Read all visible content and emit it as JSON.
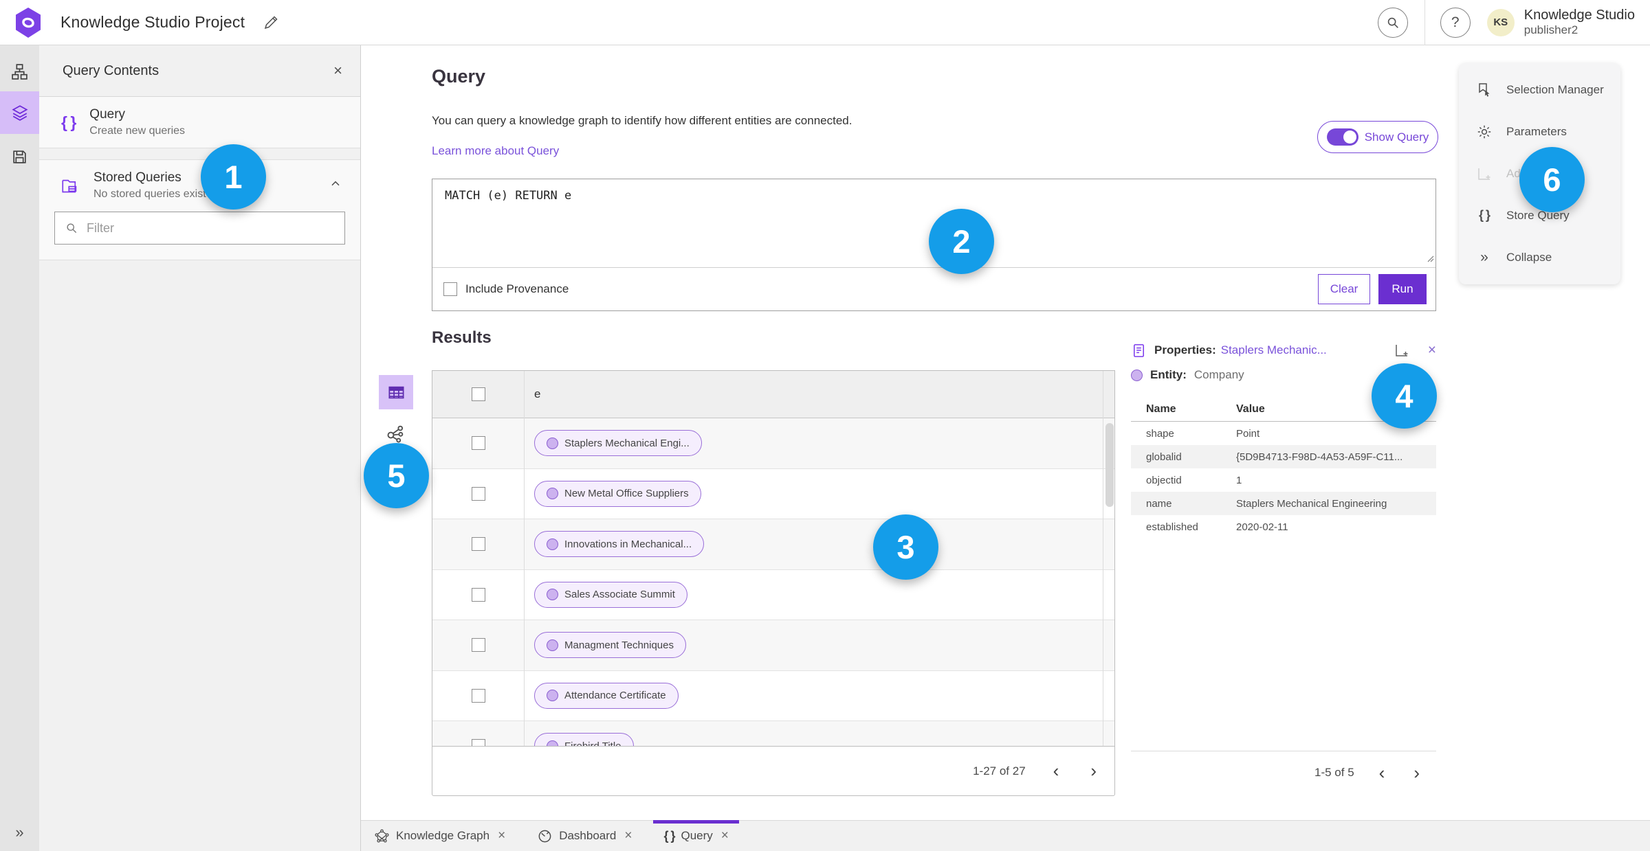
{
  "header": {
    "app_title": "Knowledge Studio Project",
    "user_name": "Knowledge Studio",
    "user_role": "publisher2",
    "avatar_initials": "KS"
  },
  "icons": {
    "braces": "{ }",
    "help": "?",
    "close": "×",
    "chevron_left": "‹",
    "chevron_right": "›",
    "collapse": "»",
    "expand": "»"
  },
  "left_panel": {
    "title": "Query Contents",
    "query_item": {
      "title": "Query",
      "subtitle": "Create new queries"
    },
    "stored_queries": {
      "title": "Stored Queries",
      "subtitle": "No stored queries exist"
    },
    "filter_placeholder": "Filter"
  },
  "query_section": {
    "title": "Query",
    "description": "You can query a knowledge graph to identify how different entities are connected.",
    "learn_more": "Learn more about Query",
    "show_query_label": "Show Query",
    "query_text": "MATCH (e) RETURN e",
    "include_provenance_label": "Include Provenance",
    "clear_label": "Clear",
    "run_label": "Run"
  },
  "results": {
    "title": "Results",
    "column_header": "e",
    "rows": [
      {
        "label": "Staplers Mechanical Engi..."
      },
      {
        "label": "New Metal Office Suppliers"
      },
      {
        "label": "Innovations in Mechanical..."
      },
      {
        "label": "Sales Associate Summit"
      },
      {
        "label": "Managment Techniques"
      },
      {
        "label": "Attendance Certificate"
      },
      {
        "label": "Firebird Title"
      }
    ],
    "pagination": "1-27 of 27"
  },
  "properties": {
    "title_label": "Properties:",
    "title_link": "Staplers Mechanic...",
    "entity_label": "Entity:",
    "entity_value": "Company",
    "columns": {
      "name": "Name",
      "value": "Value"
    },
    "rows": [
      {
        "name": "shape",
        "value": "Point"
      },
      {
        "name": "globalid",
        "value": "{5D9B4713-F98D-4A53-A59F-C11..."
      },
      {
        "name": "objectid",
        "value": "1"
      },
      {
        "name": "name",
        "value": "Staplers Mechanical Engineering"
      },
      {
        "name": "established",
        "value": "2020-02-11"
      }
    ],
    "pagination": "1-5 of 5"
  },
  "right_menu": {
    "items": [
      {
        "label": "Selection Manager"
      },
      {
        "label": "Parameters"
      },
      {
        "label": "Ad"
      },
      {
        "label": "Store Query"
      },
      {
        "label": "Collapse"
      }
    ]
  },
  "bottom_tabs": {
    "tabs": [
      {
        "label": "Knowledge Graph"
      },
      {
        "label": "Dashboard"
      },
      {
        "label": "Query"
      }
    ]
  },
  "callouts": [
    "1",
    "2",
    "3",
    "4",
    "5",
    "6"
  ],
  "colors": {
    "accent_purple": "#7747d8",
    "run_button_purple": "#6b2fd0",
    "callout_blue": "#149de9",
    "active_rail_purple": "#d6bdf8",
    "entity_pill_fill": "#f5eefd",
    "entity_pill_border": "#9a6fd8"
  }
}
